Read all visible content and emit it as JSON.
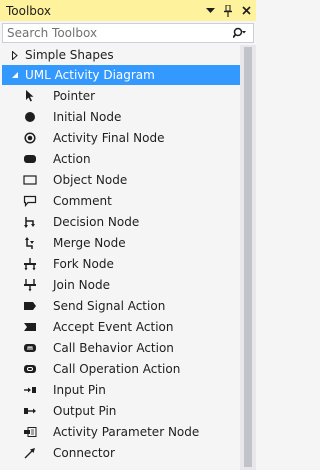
{
  "window": {
    "title": "Toolbox"
  },
  "search": {
    "placeholder": "Search Toolbox"
  },
  "groups": [
    {
      "label": "Simple Shapes",
      "expanded": false
    },
    {
      "label": "UML Activity Diagram",
      "expanded": true
    }
  ],
  "items": [
    {
      "label": "Pointer",
      "icon": "pointer-icon"
    },
    {
      "label": "Initial Node",
      "icon": "initial-node-icon"
    },
    {
      "label": "Activity Final Node",
      "icon": "activity-final-node-icon"
    },
    {
      "label": "Action",
      "icon": "action-icon"
    },
    {
      "label": "Object Node",
      "icon": "object-node-icon"
    },
    {
      "label": "Comment",
      "icon": "comment-icon"
    },
    {
      "label": "Decision Node",
      "icon": "decision-node-icon"
    },
    {
      "label": "Merge Node",
      "icon": "merge-node-icon"
    },
    {
      "label": "Fork Node",
      "icon": "fork-node-icon"
    },
    {
      "label": "Join Node",
      "icon": "join-node-icon"
    },
    {
      "label": "Send Signal Action",
      "icon": "send-signal-action-icon"
    },
    {
      "label": "Accept Event Action",
      "icon": "accept-event-action-icon"
    },
    {
      "label": "Call Behavior Action",
      "icon": "call-behavior-action-icon"
    },
    {
      "label": "Call Operation Action",
      "icon": "call-operation-action-icon"
    },
    {
      "label": "Input Pin",
      "icon": "input-pin-icon"
    },
    {
      "label": "Output Pin",
      "icon": "output-pin-icon"
    },
    {
      "label": "Activity Parameter Node",
      "icon": "activity-parameter-node-icon"
    },
    {
      "label": "Connector",
      "icon": "connector-icon"
    }
  ],
  "colors": {
    "title_bar": "#fff29d",
    "selection": "#3399ff"
  }
}
